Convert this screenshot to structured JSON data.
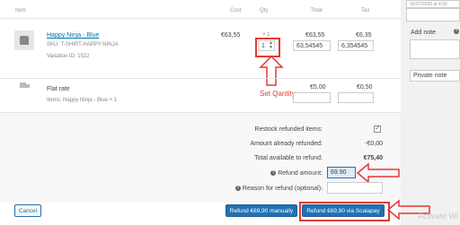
{
  "table": {
    "headers": {
      "item": "Item",
      "cost": "Cost",
      "qty": "Qty",
      "total": "Total",
      "tax": "Tax"
    }
  },
  "product": {
    "name": "Happy Ninja - Blue",
    "sku": "SKU: T-SHIRT-HAPPY-NINJA",
    "variation": "Variation ID: 1522",
    "cost": "€63,55",
    "qty_ordered": "× 1",
    "total": "€63,55",
    "tax": "€6,35",
    "refund_qty": "1",
    "refund_total": "63,54545",
    "refund_tax": "6,354545"
  },
  "shipping": {
    "name": "Flat rate",
    "items": "Items: Happy Ninja - Blue × 1",
    "total": "€5,00",
    "tax": "€0,50"
  },
  "annotation": {
    "set_quantity": "Set Qantity"
  },
  "refund": {
    "restock_label": "Restock refunded items:",
    "already_label": "Amount already refunded:",
    "already_value": "-€0,00",
    "available_label": "Total available to refund:",
    "available_value": "€75,40",
    "amount_label": "Refund amount:",
    "amount_value": "69.90",
    "reason_label": "Reason for refund (optional):"
  },
  "buttons": {
    "cancel": "Cancel",
    "manual": "Refund €69,90 manually",
    "scalapay": "Refund €69,90 via Scalapay"
  },
  "sidebar": {
    "date": "02/07/2020 at 4:03",
    "add_note": "Add note",
    "note_type": "Private note"
  },
  "watermark": "Activate Wi",
  "colors": {
    "accent": "#2271b1",
    "annotation": "#e53935"
  }
}
